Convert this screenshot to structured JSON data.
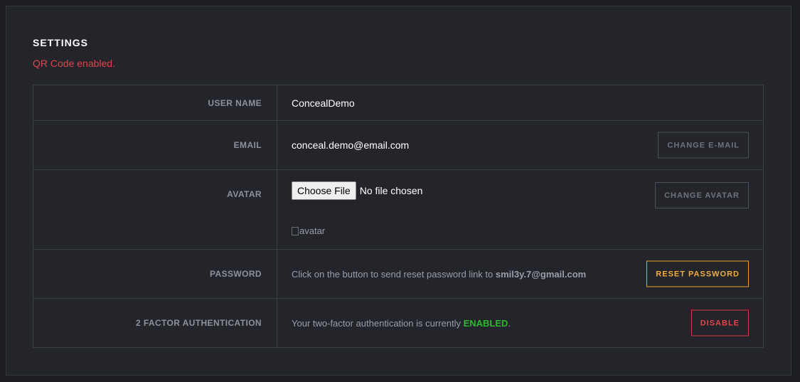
{
  "settings": {
    "title": "SETTINGS",
    "notice": "QR Code enabled."
  },
  "rows": {
    "username": {
      "label": "USER NAME",
      "value": "ConcealDemo"
    },
    "email": {
      "label": "EMAIL",
      "value": "conceal.demo@email.com",
      "button": "CHANGE E-MAIL"
    },
    "avatar": {
      "label": "AVATAR",
      "file_button": "Choose File",
      "file_status": "No file chosen",
      "image_alt": "avatar",
      "button": "CHANGE AVATAR"
    },
    "password": {
      "label": "PASSWORD",
      "text": "Click on the button to send reset password link to ",
      "email": "smil3y.7@gmail.com",
      "button": "RESET PASSWORD"
    },
    "twofa": {
      "label": "2 FACTOR AUTHENTICATION",
      "text": "Your two-factor authentication is currently ",
      "status": "ENABLED",
      "suffix": ".",
      "button": "DISABLE"
    }
  },
  "colors": {
    "background": "#1c1e22",
    "panel": "#23252a",
    "notice": "#e0434b",
    "warn": "#f0ad3c",
    "danger": "#e5434b",
    "enabled": "#2fb82f"
  },
  "icons": {
    "avatar_placeholder": "broken-image-icon"
  }
}
